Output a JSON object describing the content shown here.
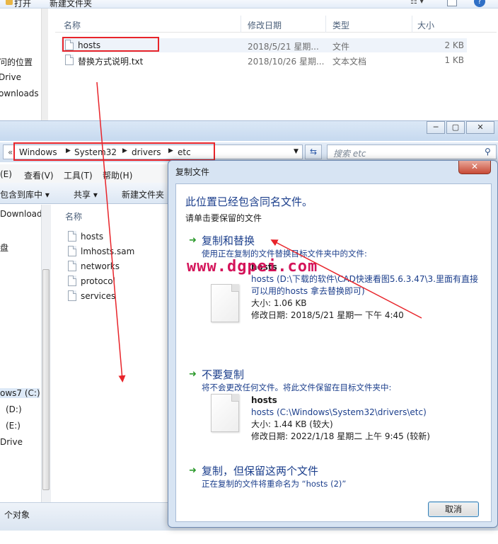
{
  "top_window": {
    "toolbar": {
      "open_label": "打开",
      "new_folder_label": "新建文件夹"
    },
    "nav_items": [
      "问的位置",
      "Drive",
      "ownloads"
    ],
    "columns": {
      "name": "名称",
      "date": "修改日期",
      "type": "类型",
      "size": "大小"
    },
    "files": [
      {
        "name": "hosts",
        "date": "2018/5/21 星期...",
        "type": "文件",
        "size": "2 KB"
      },
      {
        "name": "替换方式说明.txt",
        "date": "2018/10/26 星期...",
        "type": "文本文档",
        "size": "1 KB"
      }
    ]
  },
  "second_window": {
    "caption_buttons": {
      "minimize": "─",
      "maximize": "▢",
      "close": "✕"
    },
    "address": {
      "prefix": "«",
      "crumbs": [
        "Windows",
        "System32",
        "drivers",
        "etc"
      ]
    },
    "search": {
      "placeholder": "搜索 etc"
    },
    "menu": {
      "edit": "(E)",
      "view": "查看(V)",
      "tools": "工具(T)",
      "help": "帮助(H)"
    },
    "commands": {
      "include": "包含到库中 ▾",
      "share": "共享 ▾",
      "new_folder": "新建文件夹"
    },
    "nav_items": [
      "Downloads",
      "盘",
      "ows7 (C:)",
      "(D:)",
      "(E:)",
      "Drive"
    ],
    "column_name": "名称",
    "files": [
      "hosts",
      "lmhosts.sam",
      "networks",
      "protocol",
      "services"
    ],
    "status": "个对象"
  },
  "dialog": {
    "title": "复制文件",
    "close_label": "✕",
    "heading": "此位置已经包含同名文件。",
    "sub": "请单击要保留的文件",
    "option_replace": {
      "title": "复制和替换",
      "desc": "使用正在复制的文件替换目标文件夹中的文件:",
      "file_name": "hosts",
      "path": "hosts (D:\\下载的软件\\CAD快速看图5.6.3.47\\3.里面有直接可以用的hosts 拿去替换即可)",
      "size": "大小: 1.06 KB",
      "modified": "修改日期: 2018/5/21 星期一 下午 4:40"
    },
    "option_skip": {
      "title": "不要复制",
      "desc": "将不会更改任何文件。将此文件保留在目标文件夹中:",
      "file_name": "hosts",
      "path": "hosts (C:\\Windows\\System32\\drivers\\etc)",
      "size": "大小: 1.44 KB (较大)",
      "modified": "修改日期: 2022/1/18 星期二 上午 9:45 (较新)"
    },
    "option_keep_both": {
      "title": "复制，但保留这两个文件",
      "desc": "正在复制的文件将重命名为 “hosts (2)”"
    },
    "cancel_label": "取消"
  },
  "watermark": "www.dgpei.com",
  "colors": {
    "annotation_red": "#e8242a",
    "link_blue": "#1c3f8c",
    "watermark": "#d4145a"
  }
}
